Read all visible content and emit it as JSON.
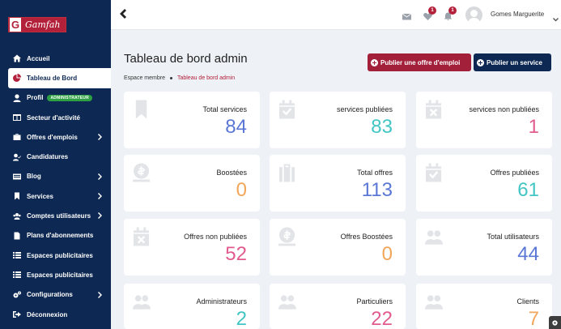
{
  "app": {
    "logo_text": "Gamfah",
    "logo_letter": "G"
  },
  "sidebar": {
    "items": [
      {
        "label": "Accueil",
        "icon": "home-icon"
      },
      {
        "label": "Tableau de Bord",
        "icon": "pie-chart-icon",
        "active": true
      },
      {
        "label": "Profil",
        "icon": "user-icon",
        "badge": "ADMINISTRATEUR"
      },
      {
        "label": "Secteur d'activité",
        "icon": "columns-icon"
      },
      {
        "label": "Offres d'emplois",
        "icon": "briefcase-icon",
        "has_children": true
      },
      {
        "label": "Candidatures",
        "icon": "user-check-icon"
      },
      {
        "label": "Blog",
        "icon": "blog-icon",
        "has_children": true
      },
      {
        "label": "Services",
        "icon": "bookmark-icon",
        "has_children": true
      },
      {
        "label": "Comptes utilisateurs",
        "icon": "users-icon",
        "has_children": true
      },
      {
        "label": "Plans d'abonnements",
        "icon": "document-icon"
      },
      {
        "label": "Espaces publicitaires",
        "icon": "list-icon"
      },
      {
        "label": "Espaces publicitaires",
        "icon": "list-icon"
      },
      {
        "label": "Configurations",
        "icon": "gears-icon",
        "has_children": true
      },
      {
        "label": "Déconnexion",
        "icon": "logout-icon"
      }
    ]
  },
  "topbar": {
    "messages_count": "",
    "favorites_count": "1",
    "notifications_count": "1",
    "user_name": "Gomes Marguerite"
  },
  "header": {
    "title": "Tableau de bord admin",
    "breadcrumb": [
      "Espace membre",
      "Tableau de bord admin"
    ],
    "buttons": {
      "publish_offer": "Publier une offre d'emploi",
      "publish_service": "Publier un service"
    }
  },
  "stats": [
    {
      "label": "Total services",
      "value": "84",
      "color": "#5a77d6",
      "icon": "bookmark-icon"
    },
    {
      "label": "services publiées",
      "value": "83",
      "color": "#42c6c3",
      "icon": "calendar-check-icon"
    },
    {
      "label": "services non publiées",
      "value": "1",
      "color": "#e25b8e",
      "icon": "calendar-x-icon"
    },
    {
      "label": "Boostées",
      "value": "0",
      "color": "#f2a65a",
      "icon": "money-icon"
    },
    {
      "label": "Total offres",
      "value": "113",
      "color": "#5a77d6",
      "icon": "suitcase-icon"
    },
    {
      "label": "Offres publiées",
      "value": "61",
      "color": "#42c6c3",
      "icon": "calendar-check-icon"
    },
    {
      "label": "Offres non publiées",
      "value": "52",
      "color": "#e25b8e",
      "icon": "calendar-x-icon"
    },
    {
      "label": "Offres Boostées",
      "value": "0",
      "color": "#f2a65a",
      "icon": "money-icon"
    },
    {
      "label": "Total utilisateurs",
      "value": "44",
      "color": "#5a77d6",
      "icon": "users-icon"
    },
    {
      "label": "Administrateurs",
      "value": "2",
      "color": "#42c6c3",
      "icon": "users-icon"
    },
    {
      "label": "Particuliers",
      "value": "22",
      "color": "#e25b8e",
      "icon": "users-icon"
    },
    {
      "label": "Clients",
      "value": "7",
      "color": "#f2a65a",
      "icon": "users-icon"
    }
  ]
}
